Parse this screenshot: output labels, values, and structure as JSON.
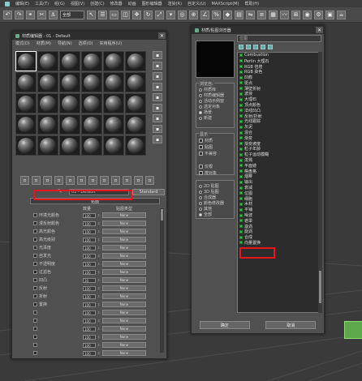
{
  "menubar": {
    "items": [
      "编辑(E)",
      "工具(T)",
      "组(G)",
      "视图(V)",
      "创建(C)",
      "修改器",
      "动画",
      "图形编辑器",
      "渲染(R)",
      "自定义(U)",
      "MAXScript(M)",
      "帮助(H)"
    ]
  },
  "toolbar": {
    "selector_value": "全部",
    "icons": [
      "undo-icon",
      "redo-icon",
      "link-icon",
      "unlink-icon",
      "bind-icon",
      "select-icon",
      "select-by-name-icon",
      "rect-select-icon",
      "window-crossing-icon",
      "move-icon",
      "rotate-icon",
      "scale-icon",
      "reference-coord-icon",
      "pivot-icon",
      "snap-icon",
      "angle-snap-icon",
      "percent-snap-icon",
      "spinner-snap-icon",
      "named-selection-icon",
      "mirror-icon",
      "align-icon",
      "layer-icon",
      "curve-editor-icon",
      "schematic-icon",
      "material-editor-icon",
      "render-setup-icon",
      "render-frame-icon",
      "render-icon"
    ]
  },
  "material_editor": {
    "title": "材质编辑器 - 01 - Default",
    "menu": [
      "模式(D)",
      "材质(M)",
      "导航(N)",
      "选项(O)",
      "实用程序(U)"
    ],
    "material_name": "01 - Default",
    "material_type": "Standard",
    "rollout_title": "贴图",
    "map_headers": {
      "amount": "数量",
      "type": "贴图类型"
    },
    "maps": [
      {
        "label": "环境光颜色",
        "amount": "100",
        "map": "None"
      },
      {
        "label": "漫反射颜色",
        "amount": "100",
        "map": "None"
      },
      {
        "label": "高光颜色",
        "amount": "100",
        "map": "None"
      },
      {
        "label": "高光级别",
        "amount": "100",
        "map": "None"
      },
      {
        "label": "光泽度",
        "amount": "100",
        "map": "None"
      },
      {
        "label": "自发光",
        "amount": "100",
        "map": "None"
      },
      {
        "label": "不透明度",
        "amount": "100",
        "map": "None"
      },
      {
        "label": "过滤色",
        "amount": "100",
        "map": "None"
      },
      {
        "label": "凹凸",
        "amount": "30",
        "map": "None"
      },
      {
        "label": "反射",
        "amount": "100",
        "map": "None"
      },
      {
        "label": "折射",
        "amount": "100",
        "map": "None"
      },
      {
        "label": "置换",
        "amount": "100",
        "map": "None"
      },
      {
        "label": "",
        "amount": "100",
        "map": "None"
      },
      {
        "label": "",
        "amount": "100",
        "map": "None"
      },
      {
        "label": "",
        "amount": "100",
        "map": "None"
      },
      {
        "label": "",
        "amount": "100",
        "map": "None"
      },
      {
        "label": "",
        "amount": "100",
        "map": "None"
      },
      {
        "label": "",
        "amount": "100",
        "map": "None"
      }
    ]
  },
  "browser": {
    "title": "材质/贴图浏览器",
    "list_header": "位图",
    "browse_from": {
      "label": "浏览自:",
      "options": [
        {
          "label": "材质库",
          "on": false
        },
        {
          "label": "材质编辑器",
          "on": false
        },
        {
          "label": "活动示例窗",
          "on": false
        },
        {
          "label": "选定对象",
          "on": false
        },
        {
          "label": "场景",
          "on": true
        },
        {
          "label": "新建",
          "on": false
        }
      ]
    },
    "show": {
      "label": "显示",
      "options": [
        "材质",
        "贴图",
        "不兼容",
        "",
        "仅根",
        "按对象"
      ]
    },
    "categories": [
      {
        "label": "2D 贴图",
        "on": false
      },
      {
        "label": "3D 贴图",
        "on": false
      },
      {
        "label": "合成器",
        "on": false
      },
      {
        "label": "颜色修改器",
        "on": false
      },
      {
        "label": "其他",
        "on": false
      },
      {
        "label": "全部",
        "on": true
      }
    ],
    "items": [
      "Combustion",
      "Perlin 大理石",
      "RGB 倍增",
      "RGB 染色",
      "凹痕",
      "斑点",
      "薄壁折射",
      "波浪",
      "大理石",
      "顶点颜色",
      "法线凹凸",
      "反射/折射",
      "光线跟踪",
      "灰泥",
      "混合",
      "渐变",
      "渐变坡度",
      "粒子年龄",
      "粒子运动模糊",
      "泼溅",
      "平面镜",
      "棋盘格",
      "烟雾",
      "输出",
      "衰减",
      "位图",
      "细胞",
      "木材",
      "平铺",
      "噪波",
      "遮罩",
      "漩涡",
      "旋涡",
      "合成",
      "向量置换"
    ],
    "highlight_item": "位图",
    "ok_label": "确定",
    "cancel_label": "取消"
  }
}
